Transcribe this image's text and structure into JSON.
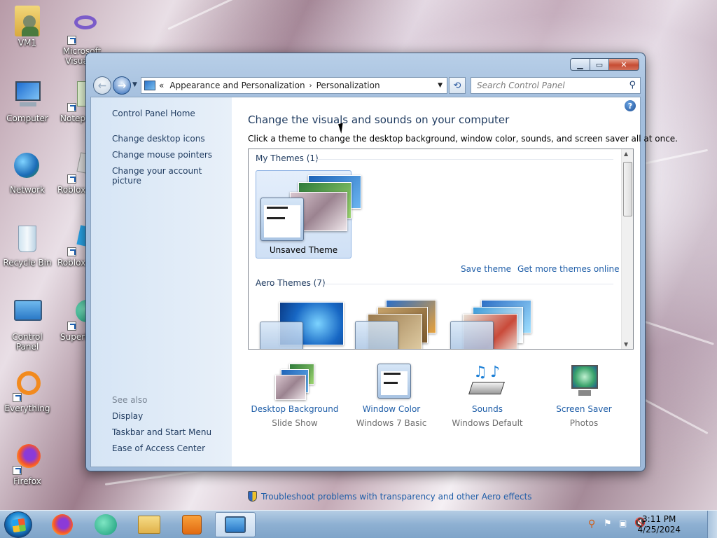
{
  "desktop": {
    "icons": [
      {
        "label": "VM1",
        "icon": "user-folder-icon"
      },
      {
        "label": "Microsoft Visual S",
        "icon": "visual-studio-icon"
      },
      {
        "label": "Computer",
        "icon": "computer-icon"
      },
      {
        "label": "Notepa",
        "icon": "notepad-icon"
      },
      {
        "label": "Network",
        "icon": "network-icon"
      },
      {
        "label": "Roblox I",
        "icon": "roblox-icon"
      },
      {
        "label": "Recycle Bin",
        "icon": "recycle-bin-icon"
      },
      {
        "label": "Roblox S",
        "icon": "roblox-studio-icon"
      },
      {
        "label": "Control Panel",
        "icon": "control-panel-icon"
      },
      {
        "label": "Superi",
        "icon": "app-icon"
      },
      {
        "label": "Everything",
        "icon": "everything-icon"
      },
      {
        "label": "Firefox",
        "icon": "firefox-icon"
      }
    ]
  },
  "window": {
    "address": {
      "prefix": "«",
      "crumb1": "Appearance and Personalization",
      "separator": "›",
      "crumb2": "Personalization"
    },
    "search_placeholder": "Search Control Panel",
    "left_pane": {
      "home": "Control Panel Home",
      "links": [
        "Change desktop icons",
        "Change mouse pointers",
        "Change your account picture"
      ],
      "see_also_label": "See also",
      "see_also": [
        "Display",
        "Taskbar and Start Menu",
        "Ease of Access Center"
      ]
    },
    "main": {
      "heading": "Change the visuals and sounds on your computer",
      "subheading": "Click a theme to change the desktop background, window color, sounds, and screen saver all at once.",
      "my_themes_header": "My Themes (1)",
      "unsaved_theme": "Unsaved Theme",
      "save_theme": "Save theme",
      "get_more_themes": "Get more themes online",
      "aero_themes_header": "Aero Themes (7)",
      "bottom_items": [
        {
          "label": "Desktop Background",
          "sub": "Slide Show",
          "icon": "desktop-background-icon"
        },
        {
          "label": "Window Color",
          "sub": "Windows 7 Basic",
          "icon": "window-color-icon"
        },
        {
          "label": "Sounds",
          "sub": "Windows Default",
          "icon": "sounds-icon"
        },
        {
          "label": "Screen Saver",
          "sub": "Photos",
          "icon": "screen-saver-icon"
        }
      ],
      "troubleshoot": "Troubleshoot problems with transparency and other Aero effects"
    }
  },
  "taskbar": {
    "time": "3:11 PM",
    "date": "4/25/2024"
  }
}
